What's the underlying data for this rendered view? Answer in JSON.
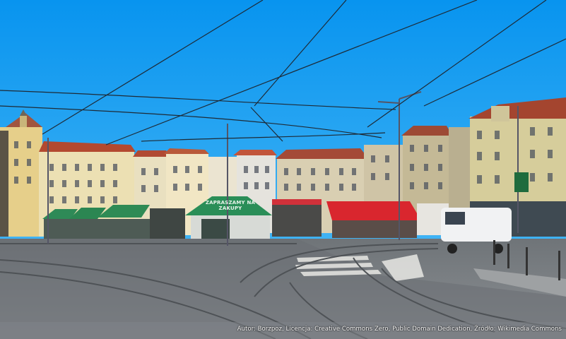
{
  "photo": {
    "subject": "Tram junction square with tenement houses and market stalls",
    "sign_text": "ZAPRASZAMY NA ZAKUPY",
    "credit": "Autor: Borzpoz, Licencja: Creative Commons Zero, Public Domain Dedication, Źródło: Wikimedia Commons"
  },
  "colors": {
    "sky": "#0c9cf0",
    "stall_green": "#2f8a55",
    "awning_red": "#d9262e",
    "pavement": "#8c8f92"
  }
}
